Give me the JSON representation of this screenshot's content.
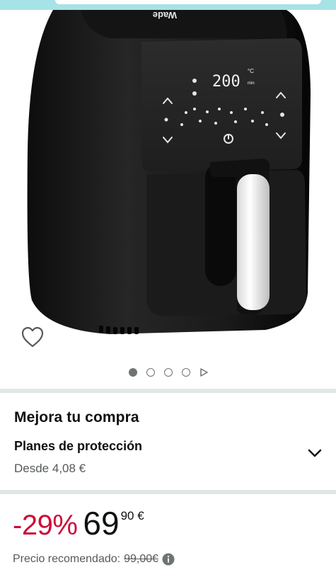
{
  "brand_text": "Wade",
  "display": {
    "temperature": "200",
    "unit_c": "°C",
    "unit_min": "min"
  },
  "product": {
    "upgrade_title": "Mejora tu compra",
    "protection_title": "Planes de protección",
    "protection_from": "Desde 4,08 €",
    "discount": "-29%",
    "price_whole": "69",
    "price_fraction": "90 €",
    "recommended_label": "Precio recomendado:",
    "recommended_price": "99,00€"
  },
  "gallery": {
    "image_count": 4,
    "active_index": 0,
    "has_video": true
  },
  "colors": {
    "accent_teal": "#a6e3e6",
    "discount_red": "#cc0c39",
    "separator": "#e3e6e6"
  },
  "icons": [
    "heart-icon",
    "play-icon",
    "chevron-down-icon",
    "info-icon"
  ]
}
